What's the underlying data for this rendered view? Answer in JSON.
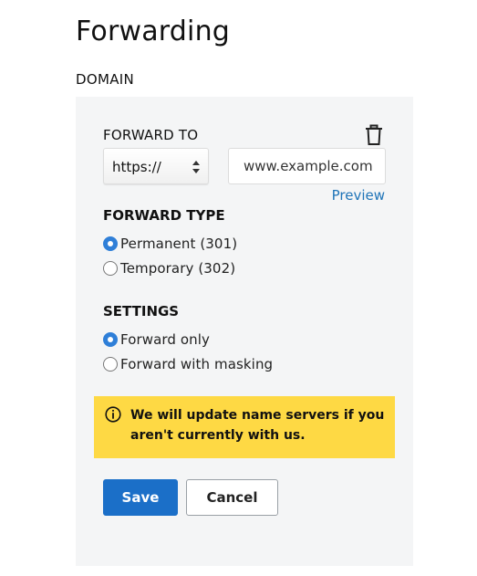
{
  "page": {
    "title": "Forwarding",
    "section_label": "DOMAIN"
  },
  "forward_to": {
    "label": "FORWARD TO",
    "delete_icon": "trash-icon",
    "protocol": {
      "selected": "https://",
      "icon": "select-arrows-icon"
    },
    "url": {
      "placeholder": "www.example.com",
      "value": ""
    },
    "preview_label": "Preview"
  },
  "forward_type": {
    "heading": "FORWARD TYPE",
    "options": [
      {
        "label": "Permanent (301)",
        "checked": true
      },
      {
        "label": "Temporary (302)",
        "checked": false
      }
    ]
  },
  "settings": {
    "heading": "SETTINGS",
    "options": [
      {
        "label": "Forward only",
        "checked": true
      },
      {
        "label": "Forward with masking",
        "checked": false
      }
    ]
  },
  "notice": {
    "icon": "info-icon",
    "text": "We will update name servers if you aren't currently with us.",
    "background": "#fed944"
  },
  "actions": {
    "save_label": "Save",
    "cancel_label": "Cancel"
  },
  "colors": {
    "accent": "#1b6fc8",
    "link": "#1f74b8",
    "panel": "#f4f5f6"
  }
}
